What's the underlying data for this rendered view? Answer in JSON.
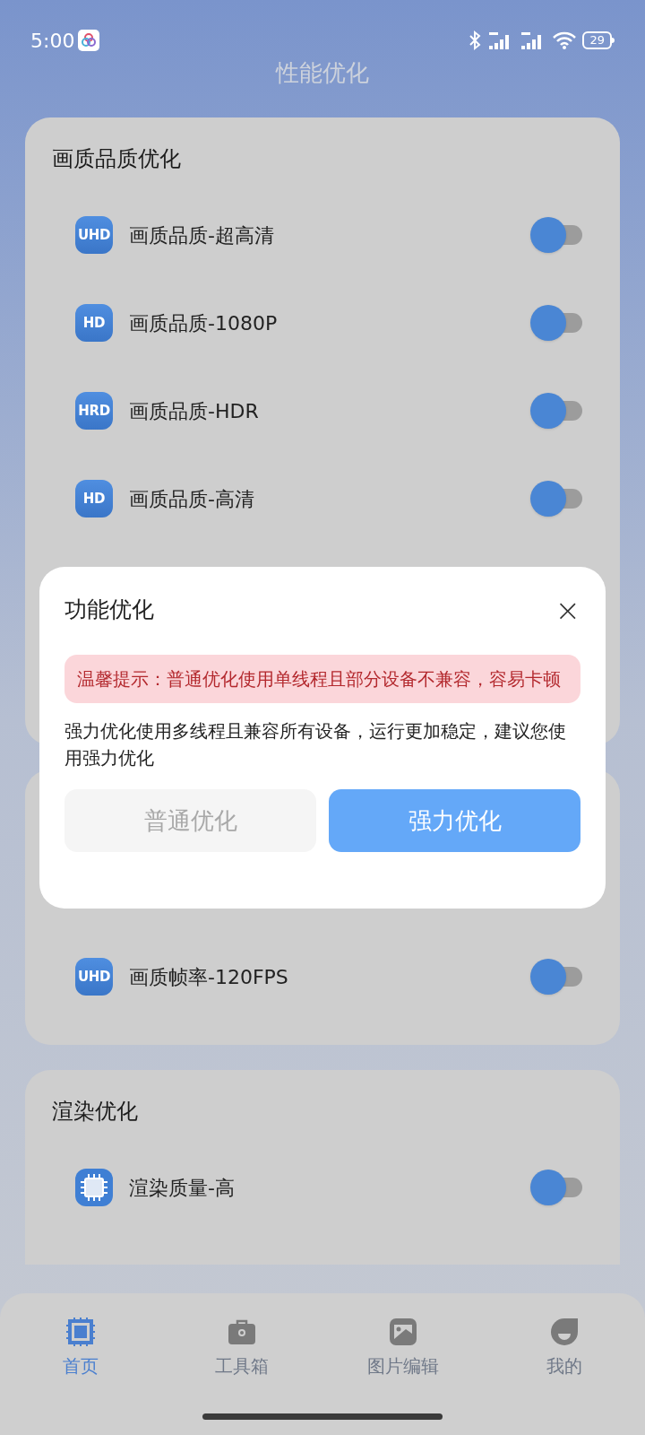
{
  "status_bar": {
    "time": "5:00",
    "battery": "29"
  },
  "title": "性能优化",
  "sections": [
    {
      "title": "画质品质优化",
      "items": [
        {
          "kind": "badge",
          "badge": "UHD",
          "label": "画质品质-超高清",
          "on": false
        },
        {
          "kind": "badge",
          "badge": "HD",
          "label": "画质品质-1080P",
          "on": false
        },
        {
          "kind": "badge",
          "badge": "HRD",
          "label": "画质品质-HDR",
          "on": false
        },
        {
          "kind": "badge",
          "badge": "HD",
          "label": "画质品质-高清",
          "on": false
        }
      ]
    },
    {
      "items": [
        {
          "kind": "badge",
          "badge": "UHD",
          "label": "画质帧率-120FPS",
          "on": false
        }
      ]
    },
    {
      "title": "渲染优化",
      "items": [
        {
          "kind": "chip",
          "label": "渲染质量-高",
          "on": false
        }
      ]
    }
  ],
  "dialog": {
    "title": "功能优化",
    "close": "×",
    "warning": "温馨提示：普通优化使用单线程且部分设备不兼容，容易卡顿",
    "message": "强力优化使用多线程且兼容所有设备，运行更加稳定，建议您使用强力优化",
    "buttons": [
      {
        "label": "普通优化",
        "primary": false
      },
      {
        "label": "强力优化",
        "primary": true
      }
    ]
  },
  "nav": [
    {
      "label": "首页",
      "selected": true
    },
    {
      "label": "工具箱",
      "selected": false
    },
    {
      "label": "图片编辑",
      "selected": false
    },
    {
      "label": "我的",
      "selected": false
    }
  ]
}
